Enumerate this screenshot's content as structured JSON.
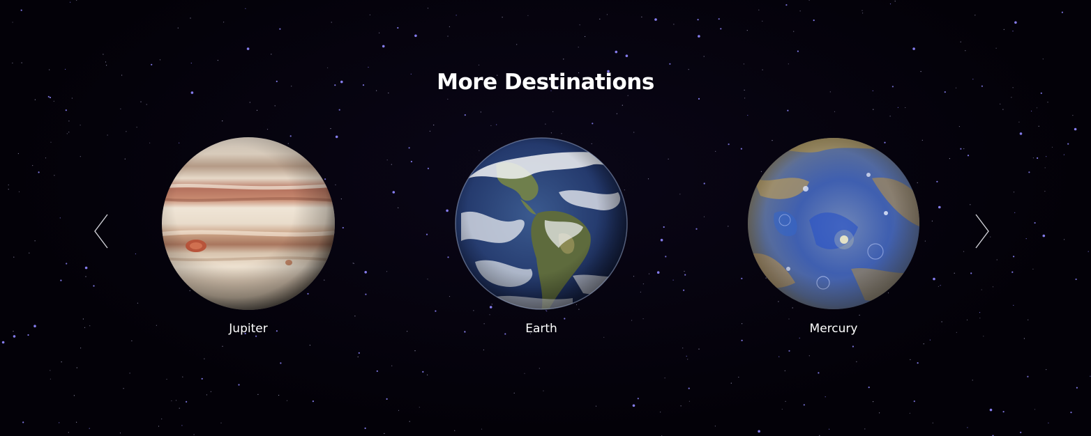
{
  "section": {
    "title": "More Destinations"
  },
  "carousel": {
    "prev_icon": "chevron-left-icon",
    "next_icon": "chevron-right-icon",
    "items": [
      {
        "label": "Jupiter",
        "image": "jupiter-planet-image"
      },
      {
        "label": "Earth",
        "image": "earth-planet-image"
      },
      {
        "label": "Mercury",
        "image": "mercury-planet-image"
      }
    ]
  },
  "colors": {
    "background": "#030108",
    "text": "#ffffff",
    "arrow": "#cfcfd6",
    "star": "#8f86ff"
  }
}
